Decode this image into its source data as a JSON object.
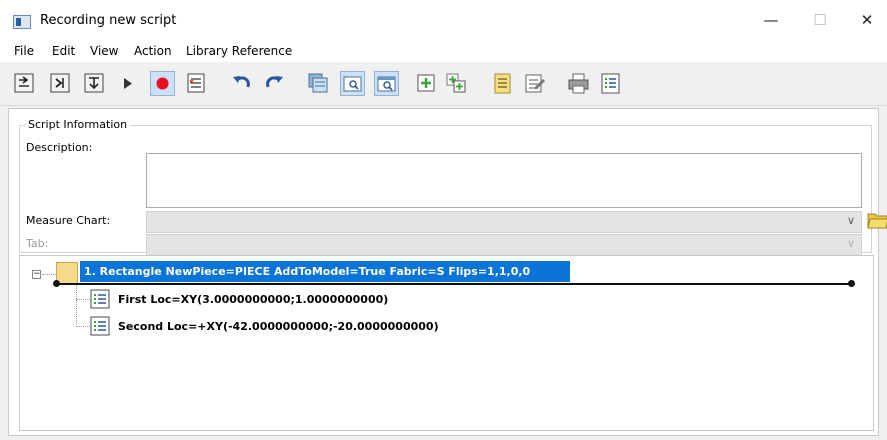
{
  "window": {
    "title": "Recording new script",
    "controls": {
      "minimize": "—",
      "maximize": "☐",
      "close": "✕"
    }
  },
  "menu": [
    "File",
    "Edit",
    "View",
    "Action",
    "Library Reference"
  ],
  "toolbar": {
    "buttons": [
      {
        "icon": "insert-step-icon"
      },
      {
        "icon": "step-into-icon"
      },
      {
        "icon": "step-over-icon"
      },
      {
        "icon": "play-icon"
      },
      {
        "icon": "record-icon",
        "active": true
      },
      {
        "icon": "script-list-icon"
      },
      {
        "icon": "undo-icon"
      },
      {
        "icon": "redo-icon"
      },
      {
        "icon": "sheets-icon"
      },
      {
        "icon": "zoom-window-icon",
        "active": true
      },
      {
        "icon": "zoom-fit-icon",
        "active": true
      },
      {
        "icon": "add-piece-icon"
      },
      {
        "icon": "add-multiple-icon"
      },
      {
        "icon": "notes-icon"
      },
      {
        "icon": "edit-notes-icon"
      },
      {
        "icon": "print-icon"
      },
      {
        "icon": "list-view-icon"
      }
    ],
    "colors": {
      "record": "#e81123",
      "accent_blue": "#2b579a",
      "green": "#3aa63a"
    }
  },
  "script_info": {
    "group_title": "Script Information",
    "description_label": "Description:",
    "description_value": "",
    "measure_chart_label": "Measure Chart:",
    "measure_chart_value": "",
    "tab_label": "Tab:",
    "tab_value": ""
  },
  "tree": {
    "expander": "⊟",
    "root": {
      "label": "1. Rectangle  NewPiece=PIECE  AddToModel=True  Fabric=S  Flips=1,1,0,0",
      "selected": true,
      "selection_color": "#0a74d8"
    },
    "children": [
      {
        "label": "First  Loc=XY(3.0000000000;1.0000000000)"
      },
      {
        "label": "Second  Loc=+XY(-42.0000000000;-20.0000000000)"
      }
    ]
  }
}
